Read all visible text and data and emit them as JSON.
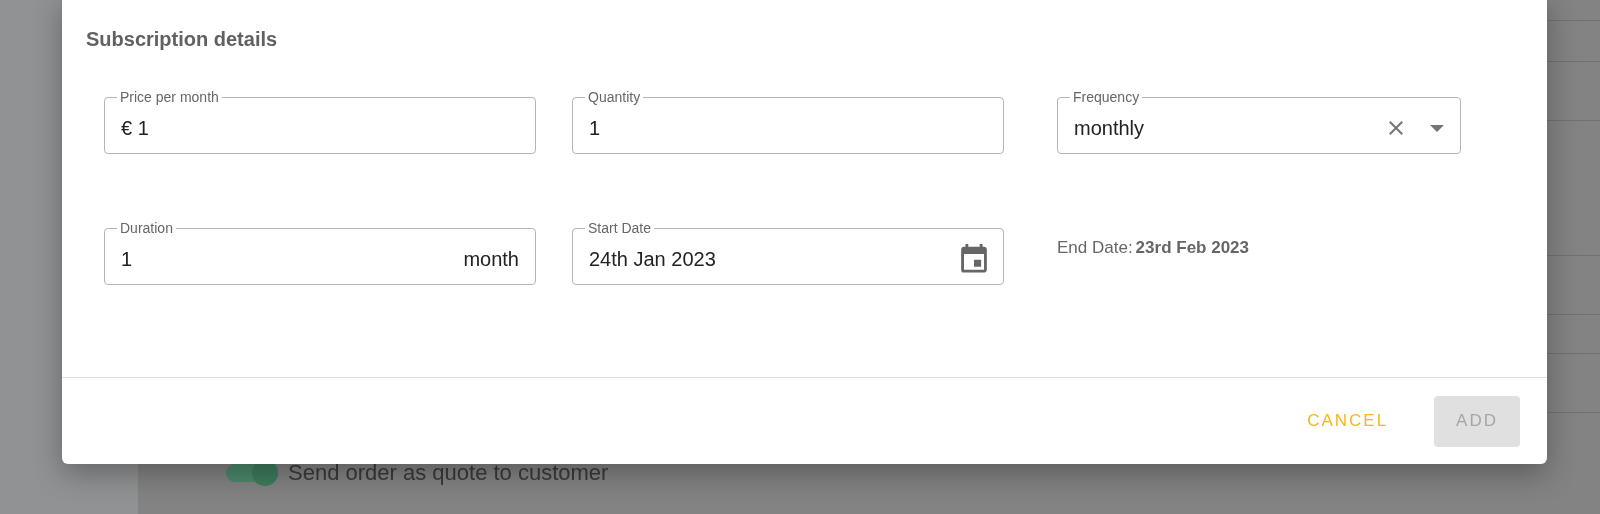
{
  "dialog": {
    "title": "Subscription details",
    "fields": [
      {
        "kind": "text",
        "label": "Price per month",
        "prefix": "€",
        "value": "1"
      },
      {
        "kind": "text",
        "label": "Quantity",
        "value": "1"
      },
      {
        "kind": "select",
        "label": "Frequency",
        "value": "monthly"
      },
      {
        "kind": "text",
        "label": "Duration",
        "value": "1",
        "suffix": "month"
      },
      {
        "kind": "date",
        "label": "Start Date",
        "value": "24th Jan 2023"
      }
    ],
    "end_date": {
      "label": "End Date:",
      "value": "23rd Feb 2023"
    },
    "buttons": [
      {
        "label": "CANCEL",
        "kind": "text",
        "disabled": false
      },
      {
        "label": "ADD",
        "kind": "contained",
        "disabled": true
      }
    ]
  },
  "background": {
    "toggle": {
      "label": "Send order as quote to customer",
      "on": true
    }
  }
}
